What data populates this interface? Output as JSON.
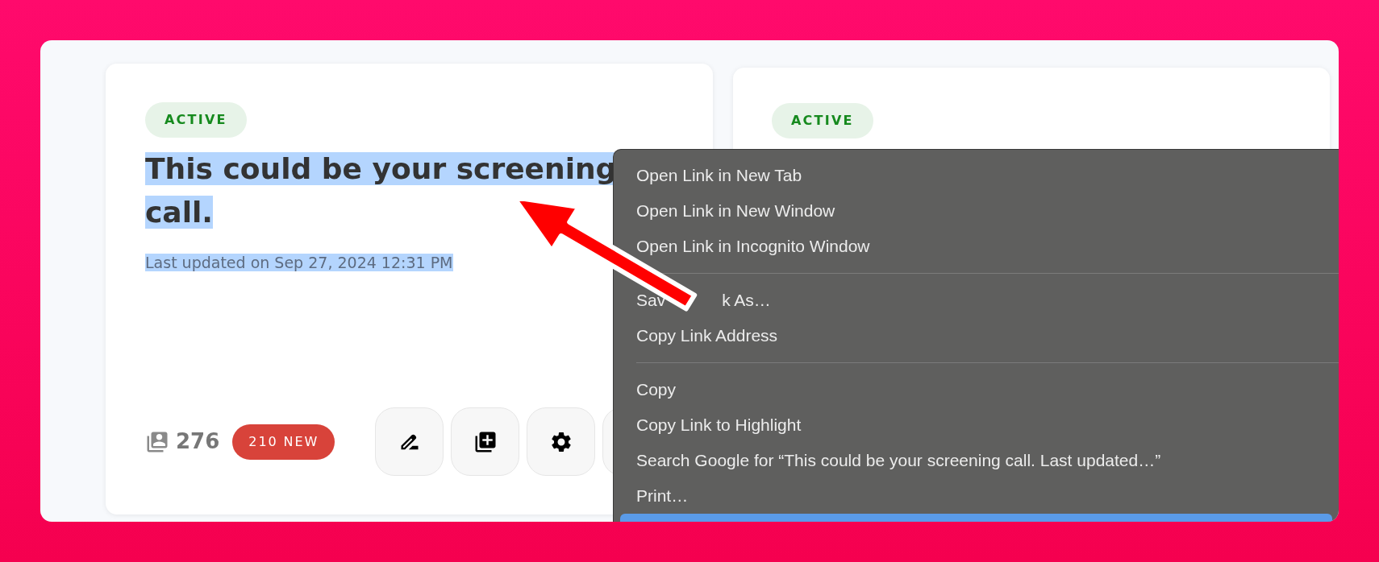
{
  "cards": [
    {
      "status": "ACTIVE",
      "title": {
        "text": "This could be your screening call.",
        "highlighted": true
      },
      "updated": {
        "text": "Last updated on Sep 27, 2024 12:31 PM",
        "highlighted": true
      },
      "count": "276",
      "new_badge": "210 NEW"
    },
    {
      "status": "ACTIVE"
    }
  ],
  "context_menu": {
    "items": [
      {
        "kind": "item",
        "label": "Open Link in New Tab",
        "selected": false
      },
      {
        "kind": "item",
        "label": "Open Link in New Window",
        "selected": false
      },
      {
        "kind": "item",
        "label": "Open Link in Incognito Window",
        "selected": false
      },
      {
        "kind": "separator"
      },
      {
        "kind": "item",
        "label_parts": [
          "Sav",
          "k As…"
        ],
        "selected": false
      },
      {
        "kind": "item",
        "label": "Copy Link Address",
        "selected": false
      },
      {
        "kind": "separator"
      },
      {
        "kind": "item",
        "label": "Copy",
        "selected": false
      },
      {
        "kind": "item",
        "label": "Copy Link to Highlight",
        "selected": false
      },
      {
        "kind": "item",
        "label": "Search Google for “This could be your screening call. Last updated…”",
        "selected": false
      },
      {
        "kind": "item",
        "label": "Print…",
        "selected": false
      },
      {
        "kind": "item",
        "selected": true
      }
    ]
  }
}
